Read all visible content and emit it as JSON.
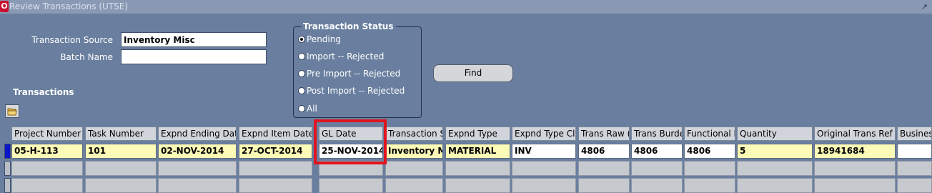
{
  "window": {
    "title": "Review Transactions (UTSE)"
  },
  "form": {
    "transaction_source_label": "Transaction Source",
    "transaction_source_value": "Inventory Misc",
    "batch_name_label": "Batch Name",
    "batch_name_value": ""
  },
  "status_group": {
    "title": "Transaction Status",
    "options": [
      {
        "label": "Pending",
        "selected": true
      },
      {
        "label": "Import -- Rejected",
        "selected": false
      },
      {
        "label": "Pre Import -- Rejected",
        "selected": false
      },
      {
        "label": "Post Import -- Rejected",
        "selected": false
      },
      {
        "label": "All",
        "selected": false
      }
    ]
  },
  "find_label": "Find",
  "section_title": "Transactions",
  "table": {
    "columns": [
      "Project Number",
      "Task Number",
      "Expnd Ending Dat",
      "Expnd Item Date",
      "GL Date",
      "Transaction S",
      "Expnd Type",
      "Expnd Type Cl",
      "Trans Raw (",
      "Trans Burde",
      "Functional F",
      "Quantity",
      "Original Trans Ref",
      "Busines"
    ],
    "row": [
      "05-H-113",
      "101",
      "02-NOV-2014",
      "27-OCT-2014",
      "25-NOV-2014",
      "Inventory Mi",
      "MATERIAL",
      "INV",
      "4806",
      "4806",
      "4806",
      "5",
      "18941684",
      ""
    ]
  },
  "colors": {
    "background": "#6a7f9f",
    "highlight": "#e0141e",
    "cell_yellow": "#fbfab6"
  }
}
